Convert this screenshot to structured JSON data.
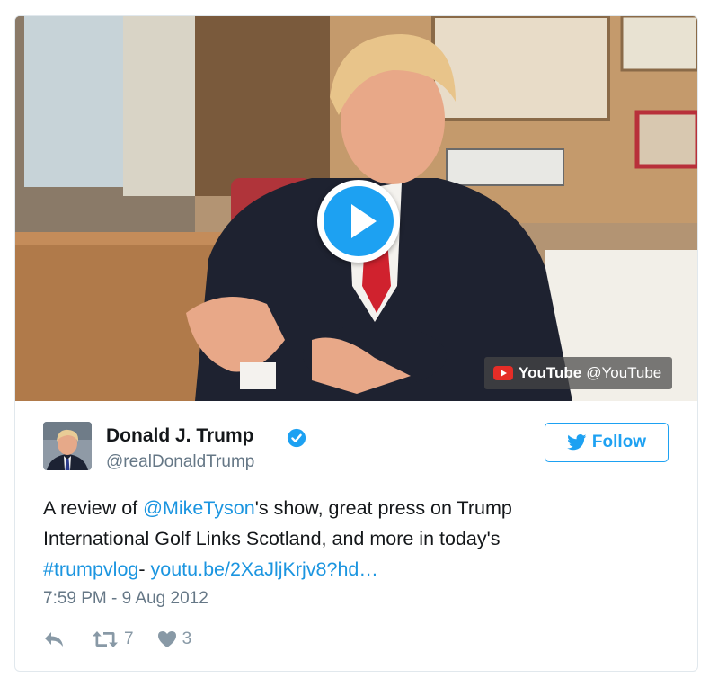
{
  "media": {
    "provider": "YouTube",
    "provider_handle": "@YouTube",
    "play_icon": "play-icon"
  },
  "tweet": {
    "author_name": "Donald J. Trump",
    "author_handle": "@realDonaldTrump",
    "verified": true,
    "follow_label": "Follow",
    "text": {
      "line1_prefix": "A review of ",
      "mention": "@MikeTyson",
      "line1_suffix": "'s show, great press on Trump",
      "line2": "International Golf Links Scotland, and more in today's",
      "hashtag": "#trumpvlog",
      "line3_sep": "- ",
      "url": "youtu.be/2XaJljKrjv8?hd…"
    },
    "timestamp": "7:59 PM - 9 Aug 2012",
    "retweets": "7",
    "likes": "3"
  },
  "colors": {
    "accent": "#1da1f2",
    "link": "#1b95e0",
    "muted": "#657786",
    "youtube_red": "#e52d27"
  }
}
